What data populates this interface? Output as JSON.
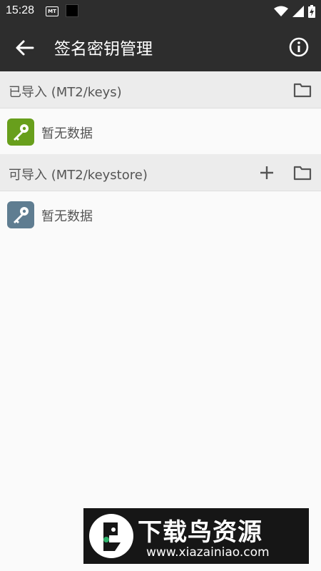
{
  "status_bar": {
    "time": "15:28",
    "notification_icon_text": "MT"
  },
  "app_bar": {
    "title": "签名密钥管理",
    "background": "#2d2d2d"
  },
  "sections": [
    {
      "title": "已导入 (MT2/keys)",
      "actions": [
        "folder-icon"
      ],
      "items": [
        {
          "label": "暂无数据",
          "icon": "key-icon",
          "color": "#689f1c"
        }
      ]
    },
    {
      "title": "可导入 (MT2/keystore)",
      "actions": [
        "add-icon",
        "folder-icon"
      ],
      "items": [
        {
          "label": "暂无数据",
          "icon": "key-icon",
          "color": "#5f7d91"
        }
      ]
    }
  ],
  "watermark": {
    "title": "下载鸟资源",
    "url": "www.xiazainiao.com"
  }
}
